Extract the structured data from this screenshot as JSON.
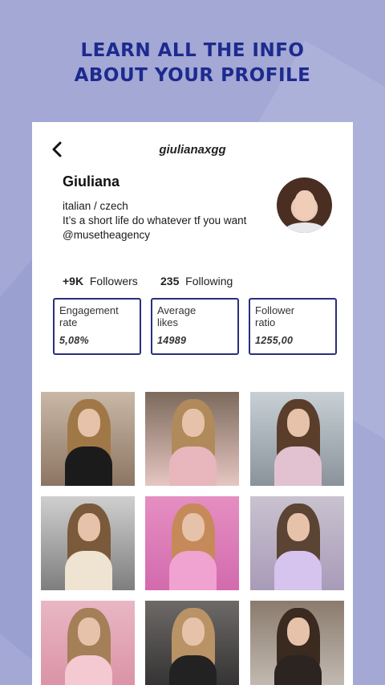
{
  "promo": {
    "line1": "LEARN ALL THE INFO",
    "line2": "ABOUT YOUR PROFILE"
  },
  "header": {
    "username": "giulianaxgg"
  },
  "profile": {
    "name": "Giuliana",
    "bio": [
      "italian / czech",
      "It’s a short life do whatever tf you want",
      "@musetheagency"
    ],
    "followers_count": "+9K",
    "followers_label": "Followers",
    "following_count": "235",
    "following_label": "Following"
  },
  "stats": [
    {
      "label_line1": "Engagement",
      "label_line2": "rate",
      "value": "5,08%"
    },
    {
      "label_line1": "Average",
      "label_line2": "likes",
      "value": "14989"
    },
    {
      "label_line1": "Follower",
      "label_line2": "ratio",
      "value": "1255,00"
    }
  ],
  "colors": {
    "background": "#a3a8d4",
    "promo_text": "#1d2a8f",
    "stat_border": "#2a2f7a"
  },
  "icons": {
    "back": "chevron-left-icon"
  }
}
